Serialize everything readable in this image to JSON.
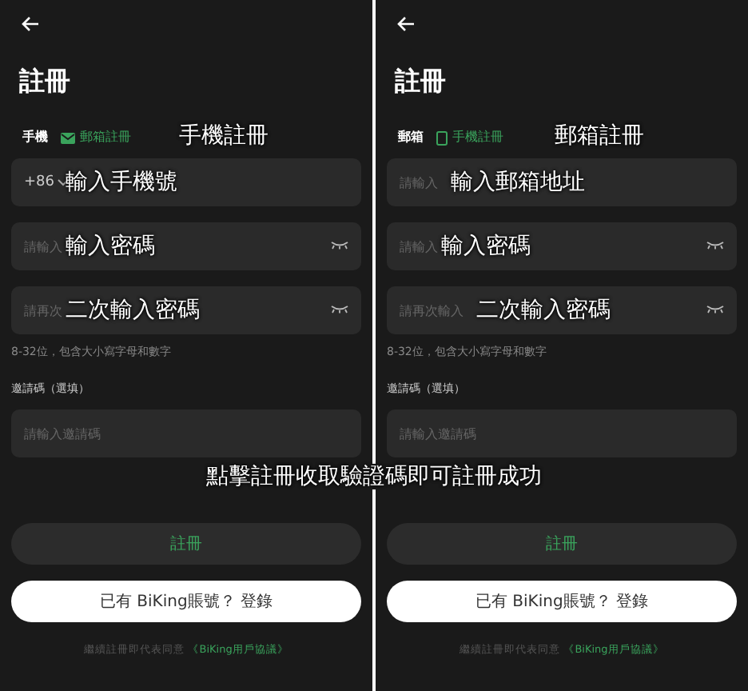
{
  "panels": [
    {
      "title": "註冊",
      "tabs": [
        {
          "label": "手機",
          "selected": true,
          "kind": "plain"
        },
        {
          "label": "郵箱註冊",
          "selected": false,
          "kind": "mail"
        }
      ],
      "tab_annotation": "手機註冊",
      "fields": [
        {
          "kind": "phone",
          "prefix": "+86",
          "annotation": "輸入手機號"
        },
        {
          "kind": "password",
          "placeholder": "請輸入",
          "annotation": "輸入密碼"
        },
        {
          "kind": "password",
          "placeholder": "請再次",
          "annotation": "二次輸入密碼"
        }
      ],
      "hint": "8-32位，包含大小寫字母和數字",
      "invite_label": "邀請碼（選填）",
      "invite_placeholder": "請輸入邀請碼",
      "submit": "註冊",
      "login": "已有 BiKing賬號？ 登錄",
      "agreement": "繼續註冊即代表同意",
      "agreement_link": "《BiKing用戶協議》"
    },
    {
      "title": "註冊",
      "tabs": [
        {
          "label": "郵箱",
          "selected": true,
          "kind": "plain"
        },
        {
          "label": "手機註冊",
          "selected": false,
          "kind": "phone"
        }
      ],
      "tab_annotation": "郵箱註冊",
      "fields": [
        {
          "kind": "email",
          "placeholder": "請輸入",
          "annotation": "輸入郵箱地址"
        },
        {
          "kind": "password",
          "placeholder": "請輸入",
          "annotation": "輸入密碼"
        },
        {
          "kind": "password",
          "placeholder": "請再次輸入",
          "annotation": "二次輸入密碼"
        }
      ],
      "hint": "8-32位，包含大小寫字母和數字",
      "invite_label": "邀請碼（選填）",
      "invite_placeholder": "請輸入邀請碼",
      "submit": "註冊",
      "login": "已有 BiKing賬號？ 登錄",
      "agreement": "繼續註冊即代表同意",
      "agreement_link": "《BiKing用戶協議》"
    }
  ],
  "center_annotation": "點擊註冊收取驗證碼即可註冊成功"
}
